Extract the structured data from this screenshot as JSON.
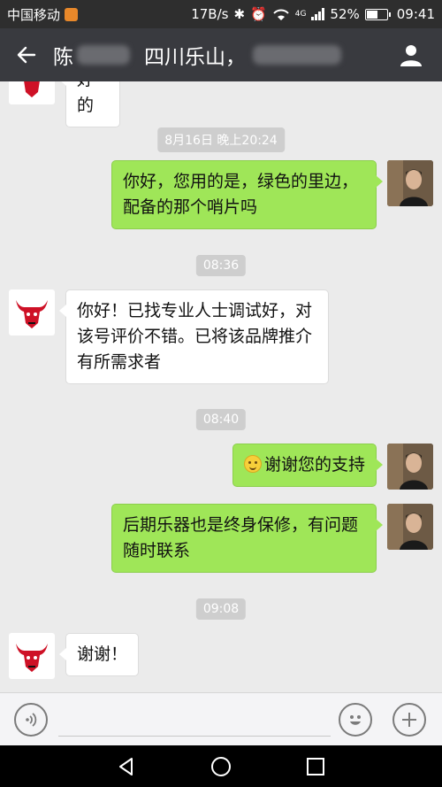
{
  "status_bar": {
    "carrier": "中国移动",
    "speed": "17B/s",
    "network": "4G",
    "battery": "52%",
    "time": "09:41"
  },
  "header": {
    "title_prefix": "陈",
    "title_middle": "四川乐山，",
    "back_icon": "back-arrow-icon",
    "profile_icon": "person-icon"
  },
  "chat": {
    "top_partial_text": "好的",
    "timestamps": [
      "8月16日 晚上20:24",
      "08:36",
      "08:40",
      "09:08"
    ],
    "messages": [
      {
        "from": "me",
        "text": "你好，您用的是，绿色的里边，配备的那个哨片吗"
      },
      {
        "from": "other",
        "text": "你好！已找专业人士调试好，对该号评价不错。已将该品牌推介有所需求者"
      },
      {
        "from": "me",
        "text": "谢谢您的支持",
        "emoji": "smile-emoji"
      },
      {
        "from": "me",
        "text": "后期乐器也是终身保修，有问题随时联系"
      },
      {
        "from": "other",
        "text": "谢谢！"
      }
    ]
  },
  "input_bar": {
    "voice_icon": "voice-icon",
    "emoji_icon": "emoji-icon",
    "plus_icon": "plus-icon"
  },
  "colors": {
    "header_bg": "#393a3f",
    "chat_bg": "#ebebeb",
    "my_bubble": "#9fe658",
    "other_bubble": "#ffffff"
  }
}
